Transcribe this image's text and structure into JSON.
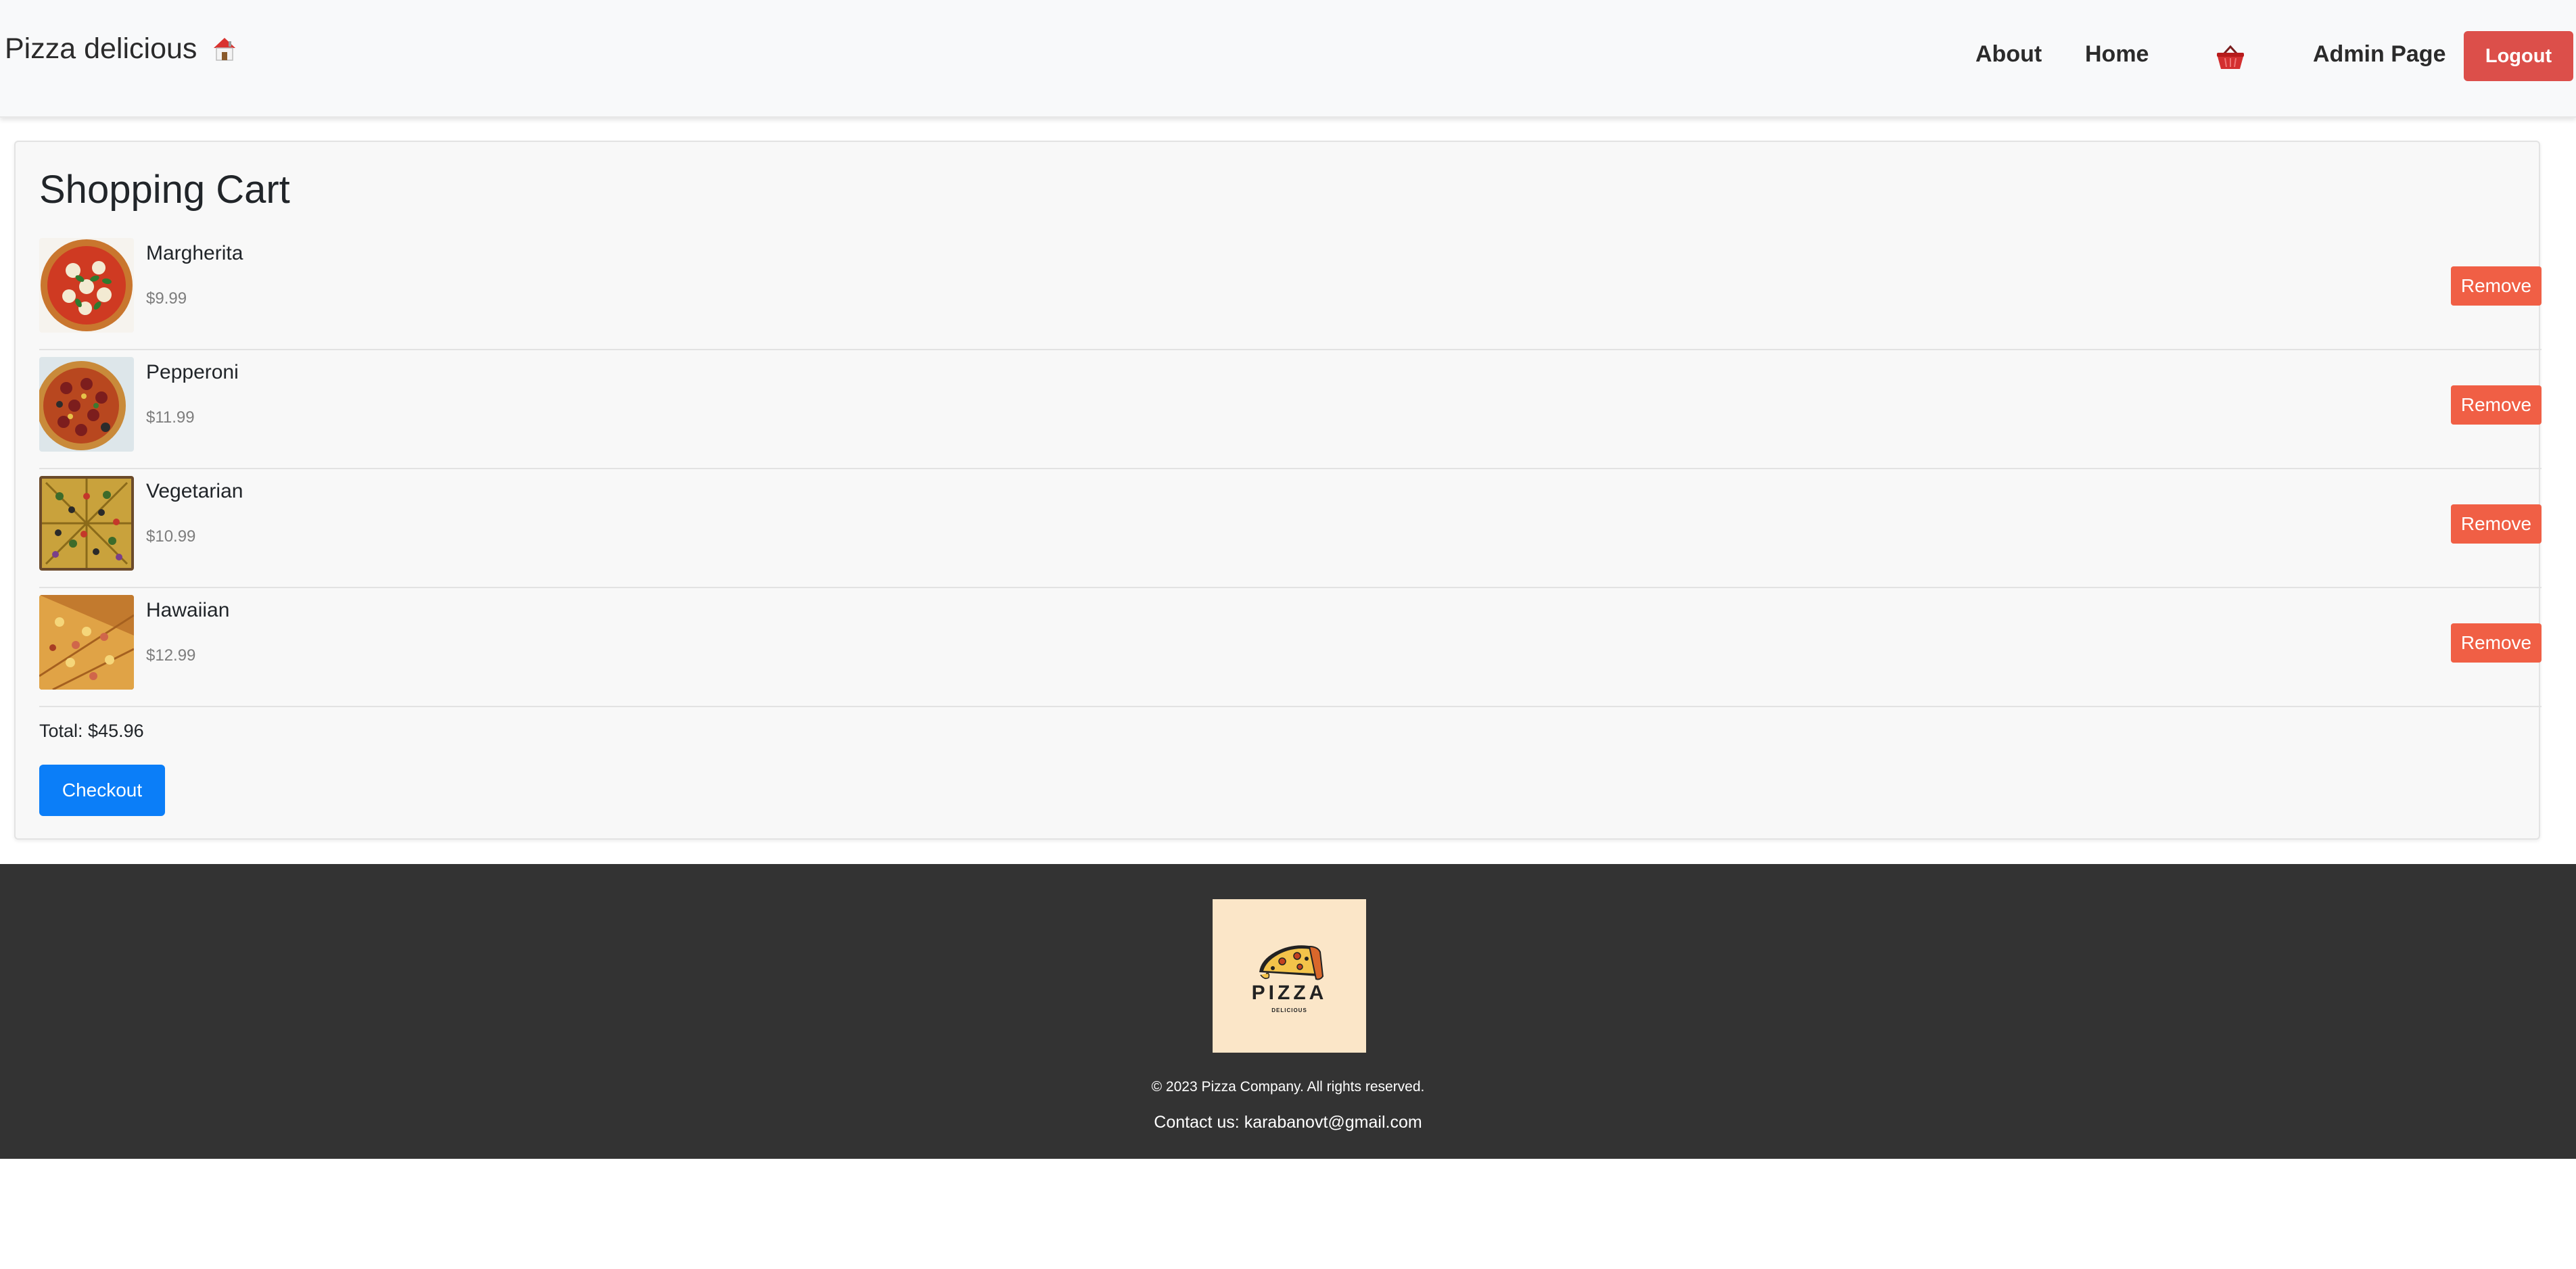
{
  "navbar": {
    "brand": "Pizza delicious",
    "brand_icon": "house-icon",
    "links": {
      "about": "About",
      "home": "Home",
      "admin": "Admin Page"
    },
    "cart_icon": "shopping-basket-icon",
    "logout_label": "Logout",
    "colors": {
      "logout": "#dc4f4a",
      "cart_icon": "#d32f2f"
    }
  },
  "cart": {
    "title": "Shopping Cart",
    "items": [
      {
        "name": "Margherita",
        "price": "$9.99",
        "image": "margherita-pizza-photo"
      },
      {
        "name": "Pepperoni",
        "price": "$11.99",
        "image": "pepperoni-pizza-photo"
      },
      {
        "name": "Vegetarian",
        "price": "$10.99",
        "image": "vegetarian-pizza-photo"
      },
      {
        "name": "Hawaiian",
        "price": "$12.99",
        "image": "hawaiian-pizza-photo"
      }
    ],
    "remove_label": "Remove",
    "total_text": "Total: $45.96",
    "checkout_label": "Checkout",
    "colors": {
      "remove": "#f05f45",
      "checkout": "#0b7ef8"
    }
  },
  "footer": {
    "logo": {
      "text": "PIZZA",
      "subtext": "DELICIOUS",
      "icon": "pizza-slice-icon",
      "background": "#fbe6c8"
    },
    "copyright": "© 2023 Pizza Company. All rights reserved.",
    "contact": "Contact us: karabanovt@gmail.com",
    "background": "#333333"
  }
}
